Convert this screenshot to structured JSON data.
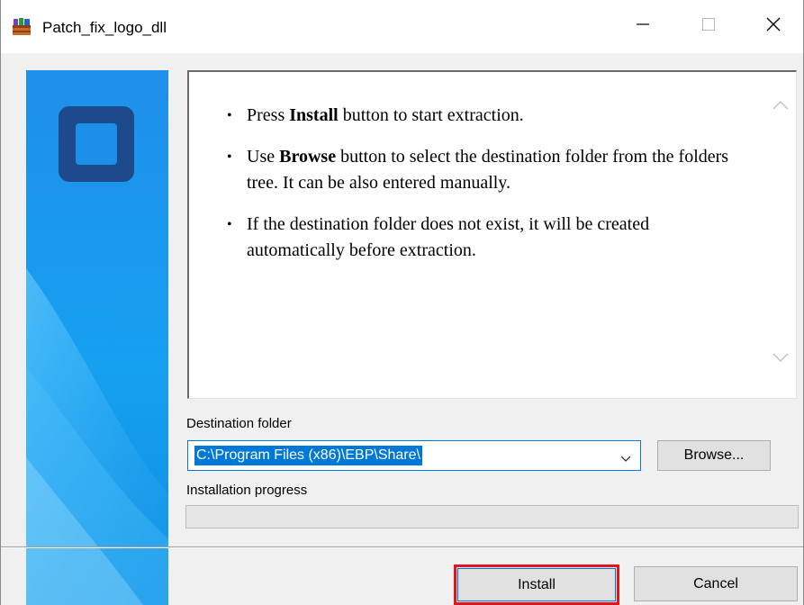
{
  "window": {
    "title": "Patch_fix_logo_dll"
  },
  "titlebar": {
    "icon": "winrar-archive-icon",
    "minimize_icon": "minimize-icon",
    "maximize_icon": "maximize-icon",
    "close_icon": "close-icon"
  },
  "info": {
    "items": [
      {
        "pre": "Press ",
        "bold": "Install",
        "post": " button to start extraction."
      },
      {
        "pre": "Use ",
        "bold": "Browse",
        "post": " button to select the destination folder from the folders tree. It can be also entered manually."
      },
      {
        "pre": "If the destination folder does not exist, it will be created automatically before extraction.",
        "bold": "",
        "post": ""
      }
    ]
  },
  "destination": {
    "label": "Destination folder",
    "value": "C:\\Program Files (x86)\\EBP\\Share\\",
    "browse_label": "Browse..."
  },
  "progress": {
    "label": "Installation progress",
    "value": 0
  },
  "buttons": {
    "install_label": "Install",
    "cancel_label": "Cancel"
  },
  "colors": {
    "accent": "#0078d7",
    "highlight_border": "#e0161e",
    "banner_blue": "#1e8fe8",
    "logo_dark": "#1d4a8c"
  }
}
